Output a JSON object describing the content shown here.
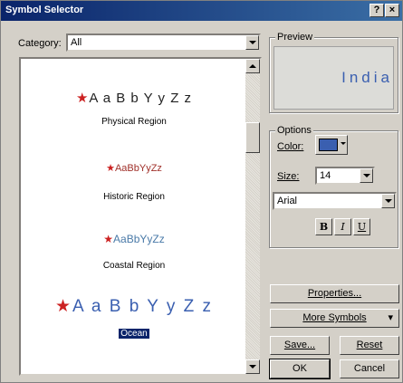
{
  "window": {
    "title": "Symbol Selector",
    "help_label": "?",
    "close_label": "×"
  },
  "category": {
    "label": "Category:",
    "value": "All"
  },
  "symbols": [
    {
      "sample": "A a B b Y y Z z",
      "name": "Physical Region"
    },
    {
      "sample": "AaBbYyZz",
      "name": "Historic Region"
    },
    {
      "sample": "AaBbYyZz",
      "name": "Coastal Region"
    },
    {
      "sample": "A a B b Y y Z z",
      "name": "Ocean",
      "selected": true
    }
  ],
  "preview": {
    "label": "Preview",
    "text": "India"
  },
  "options": {
    "label": "Options",
    "color_label": "Color:",
    "color_value": "#3a5fb0",
    "size_label": "Size:",
    "size_value": "14",
    "font_value": "Arial",
    "bold_label": "B",
    "italic_label": "I",
    "underline_label": "U"
  },
  "buttons": {
    "properties": "Properties...",
    "more_symbols": "More Symbols",
    "save": "Save...",
    "reset": "Reset",
    "ok": "OK",
    "cancel": "Cancel"
  },
  "colors": {
    "title_bar": "#0a246a",
    "accent_blue": "#3a5fb0",
    "historic_red": "#a0302a",
    "coastal_blue": "#4a7aa8",
    "star_red": "#cc2222"
  }
}
